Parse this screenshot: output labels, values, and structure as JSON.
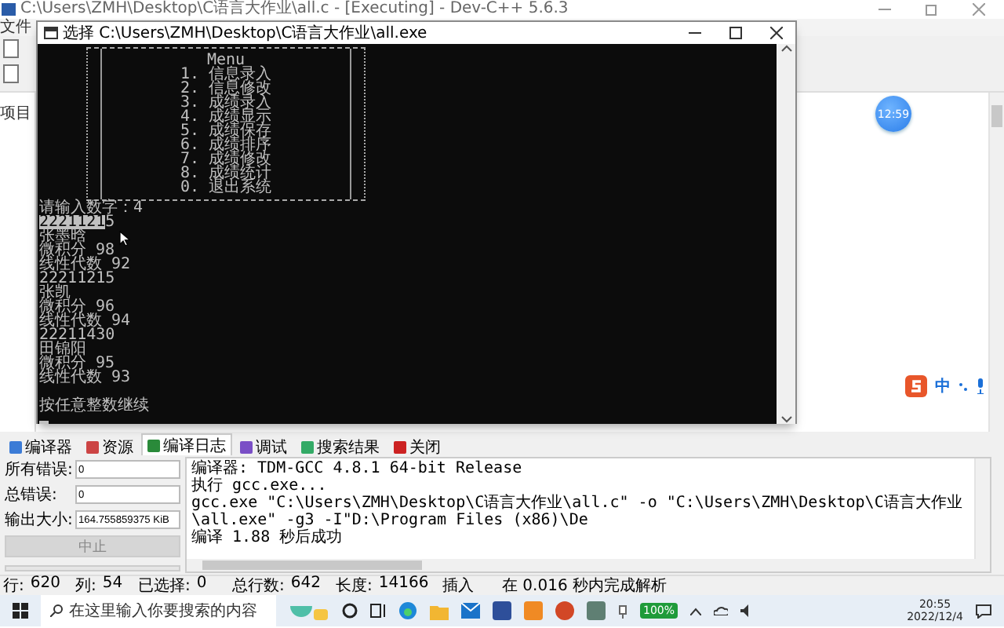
{
  "ide": {
    "title": "C:\\Users\\ZMH\\Desktop\\C语言大作业\\all.c - [Executing] - Dev-C++ 5.6.3",
    "menu": [
      "文件"
    ],
    "project_label": "项目"
  },
  "console": {
    "title": "选择 C:\\Users\\ZMH\\Desktop\\C语言大作业\\all.exe",
    "menu_title": "Menu",
    "menu_items": [
      "1. 信息录入",
      "2. 信息修改",
      "3. 成绩录入",
      "4. 成绩显示",
      "5. 成绩保存",
      "6. 成绩排序",
      "7. 成绩修改",
      "8. 成绩统计",
      "0. 退出系统"
    ],
    "lines": [
      {
        "text": "请输入数字：4"
      },
      {
        "selection": "2221121",
        "text": "5"
      },
      {
        "text": "张墨晗"
      },
      {
        "text": "微积分 98"
      },
      {
        "text": "线性代数 92"
      },
      {
        "text": "22211215"
      },
      {
        "text": "张凯"
      },
      {
        "text": "微积分 96"
      },
      {
        "text": "线性代数 94"
      },
      {
        "text": "22211430"
      },
      {
        "text": "田锦阳"
      },
      {
        "text": "微积分 95"
      },
      {
        "text": "线性代数 93"
      }
    ],
    "continue_prompt": "按任意整数继续"
  },
  "clock_bubble": "12:59",
  "ime_bar": {
    "mode": "中"
  },
  "bottom_tabs": [
    {
      "label": "编译器",
      "selected": false
    },
    {
      "label": "资源",
      "selected": false
    },
    {
      "label": "编译日志",
      "selected": true
    },
    {
      "label": "调试",
      "selected": false
    },
    {
      "label": "搜索结果",
      "selected": false
    },
    {
      "label": "关闭",
      "selected": false
    }
  ],
  "stats": [
    {
      "label": "所有错误:",
      "value": "0"
    },
    {
      "label": "总错误:",
      "value": "0"
    },
    {
      "label": "输出大小:",
      "value": "164.755859375 KiB"
    }
  ],
  "abort_button": {
    "label": "中止",
    "disabled": true
  },
  "progress_bar": {
    "level": 0
  },
  "log": [
    "编译器: TDM-GCC 4.8.1 64-bit Release",
    "执行 gcc.exe...",
    "gcc.exe \"C:\\Users\\ZMH\\Desktop\\C语言大作业\\all.c\" -o \"C:\\Users\\ZMH\\Desktop\\C语言大作业\\all.exe\" -g3 -I\"D:\\Program Files (x86)\\De",
    "编译 1.88 秒后成功"
  ],
  "status_bar": [
    {
      "label": "行:",
      "value": "620"
    },
    {
      "label": "列:",
      "value": "54"
    },
    {
      "label": "已选择:",
      "value": "0"
    },
    {
      "label": "总行数:",
      "value": "642"
    },
    {
      "label": "长度:",
      "value": "14166"
    },
    {
      "label": "插入"
    },
    {
      "label": "在 0.016 秒内完成解析"
    }
  ],
  "taskbar": {
    "search": {
      "placeholder": "在这里输入你要搜索的内容"
    },
    "battery": "100%",
    "time": "20:55",
    "date": "2022/12/4"
  }
}
